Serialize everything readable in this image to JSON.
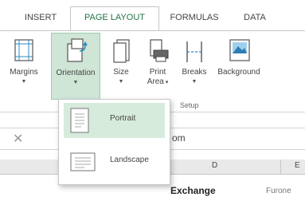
{
  "tabs": [
    {
      "label": "INSERT",
      "active": false
    },
    {
      "label": "PAGE LAYOUT",
      "active": true
    },
    {
      "label": "FORMULAS",
      "active": false
    },
    {
      "label": "DATA",
      "active": false
    }
  ],
  "ribbon": {
    "buttons": [
      {
        "label": "Margins",
        "icon": "margins-icon",
        "dropdown": true
      },
      {
        "label": "Orientation",
        "icon": "orientation-icon",
        "dropdown": true,
        "pressed": true
      },
      {
        "label": "Size",
        "icon": "size-icon",
        "dropdown": true
      },
      {
        "label": "Print Area",
        "line1": "Print",
        "line2": "Area",
        "icon": "print-area-icon",
        "dropdown": true
      },
      {
        "label": "Breaks",
        "icon": "breaks-icon",
        "dropdown": true
      },
      {
        "label": "Background",
        "icon": "background-icon",
        "dropdown": false
      }
    ],
    "group_label_visible": "Setup"
  },
  "orientation_menu": {
    "items": [
      {
        "label": "Portrait",
        "icon": "portrait-page-icon",
        "selected": true
      },
      {
        "label": "Landscape",
        "icon": "landscape-page-icon",
        "selected": false
      }
    ]
  },
  "formula_bar": {
    "cancel_symbol": "✕",
    "visible_text": "om"
  },
  "columns": [
    "D",
    "E"
  ],
  "cells": {
    "d_partial": "Exchange",
    "e_partial": "Furone"
  },
  "colors": {
    "accent": "#217346",
    "pressed_bg": "#cfe5d6",
    "arrow": "#2ea3dc"
  }
}
